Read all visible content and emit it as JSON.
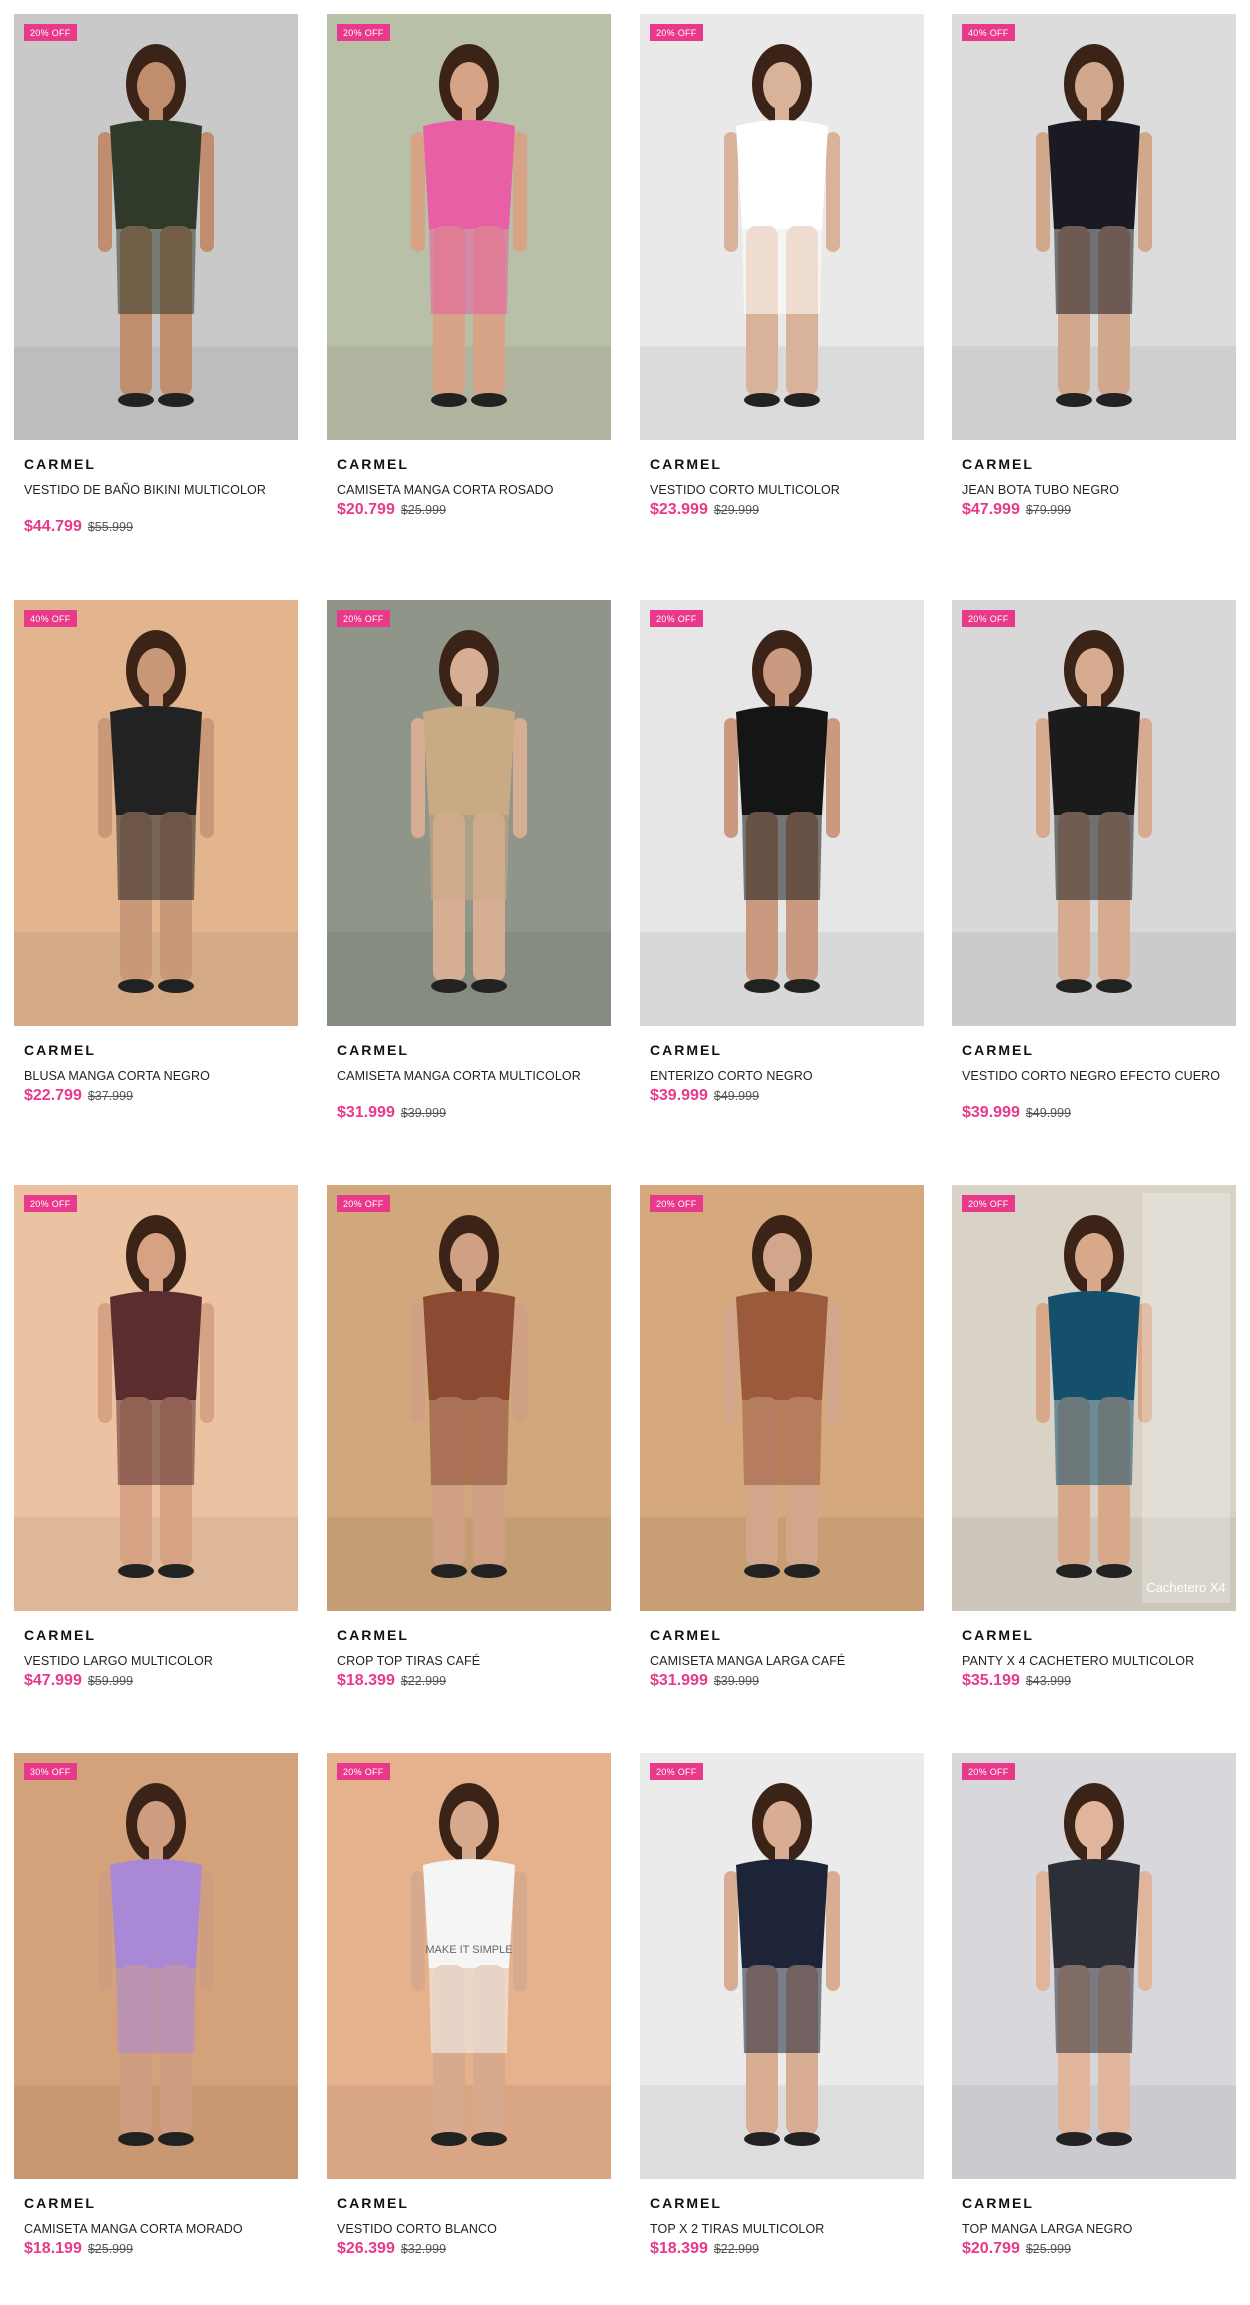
{
  "products": [
    {
      "badge": "20% OFF",
      "brand": "CARMEL",
      "name": "VESTIDO DE BAÑO BIKINI MULTICOLOR",
      "price": "$44.799",
      "old_price": "$55.999",
      "bg": "#c9c9c9",
      "accent": "#2f3a2a",
      "skin": "#c08d6e"
    },
    {
      "badge": "20% OFF",
      "brand": "CARMEL",
      "name": "CAMISETA MANGA CORTA ROSADO",
      "price": "$20.799",
      "old_price": "$25.999",
      "bg": "#b9c0a8",
      "accent": "#e85fa6",
      "skin": "#d6a386"
    },
    {
      "badge": "20% OFF",
      "brand": "CARMEL",
      "name": "VESTIDO CORTO MULTICOLOR",
      "price": "$23.999",
      "old_price": "$29.999",
      "bg": "#e9e9e9",
      "accent": "#ffffff",
      "skin": "#d9b29a"
    },
    {
      "badge": "40% OFF",
      "brand": "CARMEL",
      "name": "JEAN BOTA TUBO NEGRO",
      "price": "$47.999",
      "old_price": "$79.999",
      "bg": "#dcdcdc",
      "accent": "#1a1a22",
      "skin": "#d2a88c"
    },
    {
      "badge": "40% OFF",
      "brand": "CARMEL",
      "name": "BLUSA MANGA CORTA NEGRO",
      "price": "$22.799",
      "old_price": "$37.999",
      "bg": "#e2b58f",
      "accent": "#222222",
      "skin": "#c99878"
    },
    {
      "badge": "20% OFF",
      "brand": "CARMEL",
      "name": "CAMISETA MANGA CORTA MULTICOLOR",
      "price": "$31.999",
      "old_price": "$39.999",
      "bg": "#8f9589",
      "accent": "#c8aa84",
      "skin": "#d6ae94"
    },
    {
      "badge": "20% OFF",
      "brand": "CARMEL",
      "name": "ENTERIZO CORTO NEGRO",
      "price": "$39.999",
      "old_price": "$49.999",
      "bg": "#e6e6e6",
      "accent": "#151515",
      "skin": "#c99a7f"
    },
    {
      "badge": "20% OFF",
      "brand": "CARMEL",
      "name": "VESTIDO CORTO NEGRO EFECTO CUERO",
      "price": "$39.999",
      "old_price": "$49.999",
      "bg": "#d8d8d8",
      "accent": "#1b1b1b",
      "skin": "#d7ab90"
    },
    {
      "badge": "20% OFF",
      "brand": "CARMEL",
      "name": "VESTIDO LARGO MULTICOLOR",
      "price": "$47.999",
      "old_price": "$59.999",
      "bg": "#ecc3a2",
      "accent": "#5a2e2e",
      "skin": "#d6a283"
    },
    {
      "badge": "20% OFF",
      "brand": "CARMEL",
      "name": "CROP TOP TIRAS CAFÉ",
      "price": "$18.399",
      "old_price": "$22.999",
      "bg": "#d1a77c",
      "accent": "#8b4b33",
      "skin": "#d0a085"
    },
    {
      "badge": "20% OFF",
      "brand": "CARMEL",
      "name": "CAMISETA MANGA LARGA CAFÉ",
      "price": "$31.999",
      "old_price": "$39.999",
      "bg": "#d5a97d",
      "accent": "#9c5a3d",
      "skin": "#d2a68a"
    },
    {
      "badge": "20% OFF",
      "brand": "CARMEL",
      "name": "PANTY X 4 CACHETERO MULTICOLOR",
      "price": "$35.199",
      "old_price": "$43.999",
      "bg": "#d9d3c7",
      "accent": "#14506b",
      "skin": "#d7a98a",
      "overlay": "Cachetero X4"
    },
    {
      "badge": "30% OFF",
      "brand": "CARMEL",
      "name": "CAMISETA MANGA CORTA MORADO",
      "price": "$18.199",
      "old_price": "$25.999",
      "bg": "#d4a27a",
      "accent": "#a989d6",
      "skin": "#cf9d80"
    },
    {
      "badge": "20% OFF",
      "brand": "CARMEL",
      "name": "VESTIDO CORTO BLANCO",
      "price": "$26.399",
      "old_price": "$32.999",
      "bg": "#e6b18d",
      "accent": "#f5f5f5",
      "skin": "#d7aa8e",
      "print": "MAKE IT SIMPLE"
    },
    {
      "badge": "20% OFF",
      "brand": "CARMEL",
      "name": "TOP X 2 TIRAS MULTICOLOR",
      "price": "$18.399",
      "old_price": "$22.999",
      "bg": "#ebebeb",
      "accent": "#1d2438",
      "skin": "#d8ad93"
    },
    {
      "badge": "20% OFF",
      "brand": "CARMEL",
      "name": "TOP MANGA LARGA NEGRO",
      "price": "$20.799",
      "old_price": "$25.999",
      "bg": "#d7d7dc",
      "accent": "#2d2f38",
      "skin": "#e0b59b"
    }
  ]
}
